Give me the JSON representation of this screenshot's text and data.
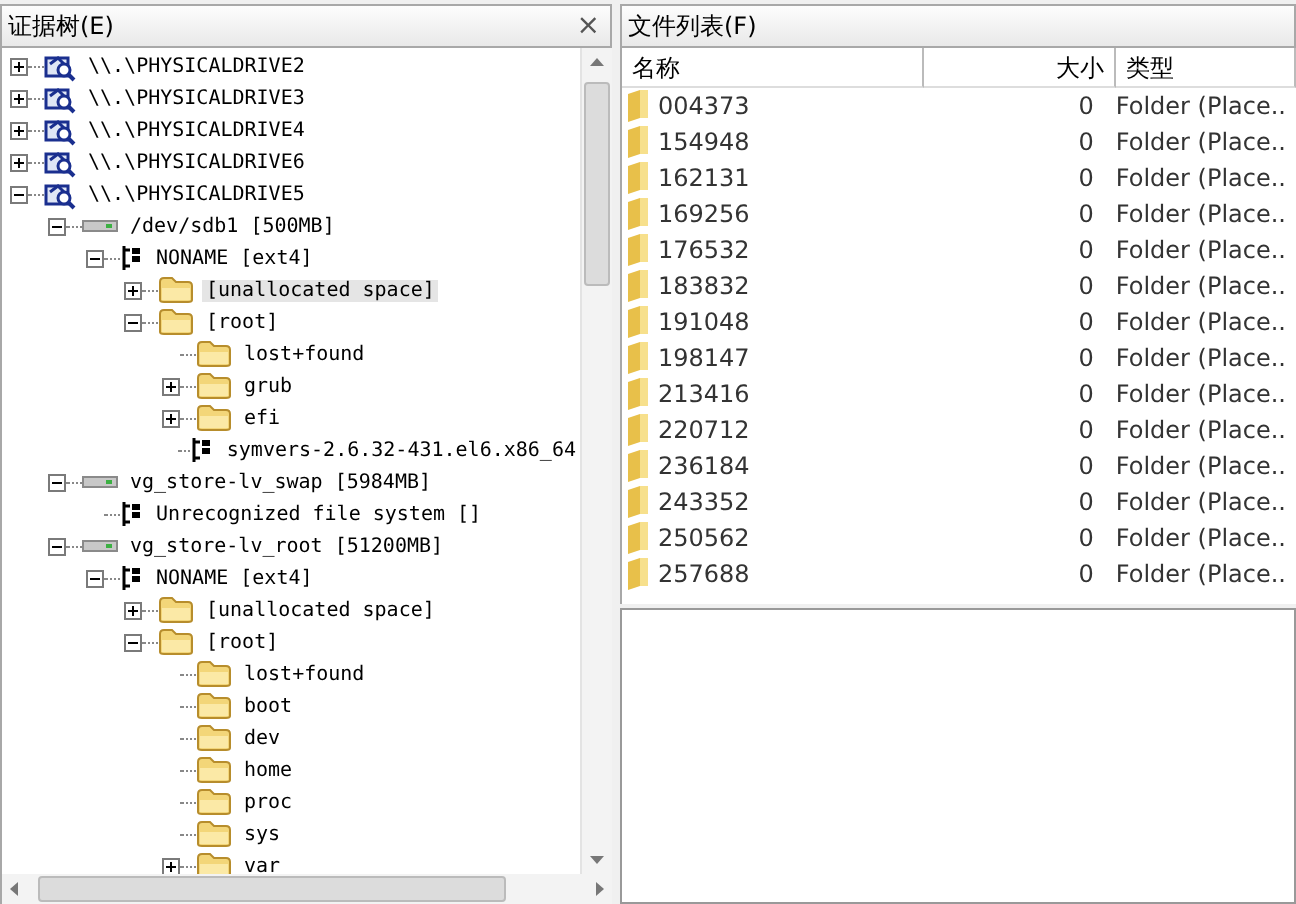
{
  "evidence_tree": {
    "title": "证据树(E)",
    "close": "×",
    "nodes": [
      {
        "kind": "drive",
        "label": "\\\\.\\PHYSICALDRIVE2",
        "expanded": false
      },
      {
        "kind": "drive",
        "label": "\\\\.\\PHYSICALDRIVE3",
        "expanded": false
      },
      {
        "kind": "drive",
        "label": "\\\\.\\PHYSICALDRIVE4",
        "expanded": false
      },
      {
        "kind": "drive",
        "label": "\\\\.\\PHYSICALDRIVE6",
        "expanded": false
      },
      {
        "kind": "drive",
        "label": "\\\\.\\PHYSICALDRIVE5",
        "expanded": true,
        "children": [
          {
            "kind": "volume",
            "label": "/dev/sdb1 [500MB]",
            "expanded": true,
            "children": [
              {
                "kind": "fs",
                "label": "NONAME [ext4]",
                "expanded": true,
                "children": [
                  {
                    "kind": "folder",
                    "label": "[unallocated space]",
                    "expanded": false,
                    "selected": true
                  },
                  {
                    "kind": "folder",
                    "label": "[root]",
                    "expanded": true,
                    "children": [
                      {
                        "kind": "folder",
                        "label": "lost+found"
                      },
                      {
                        "kind": "folder",
                        "label": "grub",
                        "expanded": false
                      },
                      {
                        "kind": "folder",
                        "label": "efi",
                        "expanded": false
                      },
                      {
                        "kind": "fs",
                        "label": "symvers-2.6.32-431.el6.x86_64"
                      }
                    ]
                  }
                ]
              }
            ]
          },
          {
            "kind": "volume",
            "label": "vg_store-lv_swap [5984MB]",
            "expanded": true,
            "children": [
              {
                "kind": "fs",
                "label": "Unrecognized file system []"
              }
            ]
          },
          {
            "kind": "volume",
            "label": "vg_store-lv_root [51200MB]",
            "expanded": true,
            "children": [
              {
                "kind": "fs",
                "label": "NONAME [ext4]",
                "expanded": true,
                "children": [
                  {
                    "kind": "folder",
                    "label": "[unallocated space]",
                    "expanded": false
                  },
                  {
                    "kind": "folder",
                    "label": "[root]",
                    "expanded": true,
                    "children": [
                      {
                        "kind": "folder",
                        "label": "lost+found"
                      },
                      {
                        "kind": "folder",
                        "label": "boot"
                      },
                      {
                        "kind": "folder",
                        "label": "dev"
                      },
                      {
                        "kind": "folder",
                        "label": "home"
                      },
                      {
                        "kind": "folder",
                        "label": "proc"
                      },
                      {
                        "kind": "folder",
                        "label": "sys"
                      },
                      {
                        "kind": "folder",
                        "label": "var",
                        "expanded": false
                      }
                    ]
                  }
                ]
              }
            ]
          }
        ]
      }
    ]
  },
  "file_list": {
    "title": "文件列表(F)",
    "columns": [
      "名称",
      "大小",
      "类型"
    ],
    "rows": [
      {
        "name": "004373",
        "size": "0",
        "type": "Folder (Place.."
      },
      {
        "name": "154948",
        "size": "0",
        "type": "Folder (Place.."
      },
      {
        "name": "162131",
        "size": "0",
        "type": "Folder (Place.."
      },
      {
        "name": "169256",
        "size": "0",
        "type": "Folder (Place.."
      },
      {
        "name": "176532",
        "size": "0",
        "type": "Folder (Place.."
      },
      {
        "name": "183832",
        "size": "0",
        "type": "Folder (Place.."
      },
      {
        "name": "191048",
        "size": "0",
        "type": "Folder (Place.."
      },
      {
        "name": "198147",
        "size": "0",
        "type": "Folder (Place.."
      },
      {
        "name": "213416",
        "size": "0",
        "type": "Folder (Place.."
      },
      {
        "name": "220712",
        "size": "0",
        "type": "Folder (Place.."
      },
      {
        "name": "236184",
        "size": "0",
        "type": "Folder (Place.."
      },
      {
        "name": "243352",
        "size": "0",
        "type": "Folder (Place.."
      },
      {
        "name": "250562",
        "size": "0",
        "type": "Folder (Place.."
      },
      {
        "name": "257688",
        "size": "0",
        "type": "Folder (Place.."
      }
    ]
  }
}
